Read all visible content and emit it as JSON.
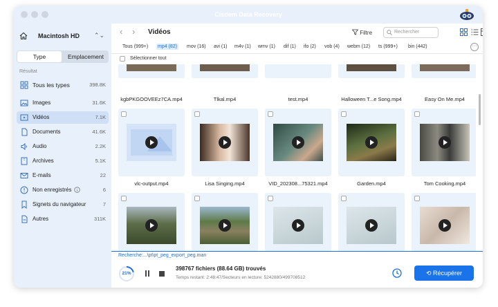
{
  "window": {
    "title": "Cisdem Data Recovery",
    "accent_color": "#1a73e8"
  },
  "sidebar": {
    "drive": "Macintosh  HD",
    "segment": {
      "type": "Type",
      "location": "Emplacement"
    },
    "result_label": "Résultat",
    "categories": [
      {
        "label": "Tous les types",
        "count": "398.8K",
        "icon": "all-types-icon"
      },
      {
        "label": "Images",
        "count": "31.6K",
        "icon": "image-icon"
      },
      {
        "label": "Vidéos",
        "count": "7.1K",
        "icon": "video-icon"
      },
      {
        "label": "Documents",
        "count": "41.6K",
        "icon": "document-icon"
      },
      {
        "label": "Audio",
        "count": "2.2K",
        "icon": "audio-icon"
      },
      {
        "label": "Archives",
        "count": "5.1K",
        "icon": "archive-icon"
      },
      {
        "label": "E-mails",
        "count": "22",
        "icon": "email-icon"
      },
      {
        "label": "Non enregistrés",
        "count": "6",
        "icon": "unsaved-icon"
      },
      {
        "label": "Signets du navigateur",
        "count": "7",
        "icon": "bookmark-icon"
      },
      {
        "label": "Autres",
        "count": "311K",
        "icon": "others-icon"
      }
    ]
  },
  "toolbar": {
    "folder_title": "Vidéos",
    "filter_label": "Filtre",
    "search_placeholder": "Rechercher"
  },
  "format_tabs": [
    "Tous (999+)",
    "mp4 (82)",
    "mov (16)",
    "avi (1)",
    "m4v (1)",
    "wmv (1)",
    "dif (1)",
    "ifo (2)",
    "vob (4)",
    "webm (12)",
    "ts (999+)",
    "bin (442)"
  ],
  "select_all_label": "Sélectionner tout",
  "files_row1": [
    "kgbPKGOOVEEz7CA.mp4",
    "Tlkal.mp4",
    "test.mp4",
    "Halloween T...e Song.mp4",
    "Easy On Me.mp4"
  ],
  "files_row2": [
    "vlc-output.mp4",
    "Lisa Singing.mp4",
    "VID_202308...75321.mp4",
    "Garden.mp4",
    "Tom Cooking.mp4"
  ],
  "path_text": "Recherche:...\\pt\\pt_peg_export_peg.man",
  "status": {
    "progress_percent": "21%",
    "files_found": "398767 fichiers (88.64 GB) trouvés",
    "time_remaining": "Temps restant: 2:48:47/Secteurs en lecture: 5242880/499708512"
  },
  "recover_label": "Récupérer"
}
